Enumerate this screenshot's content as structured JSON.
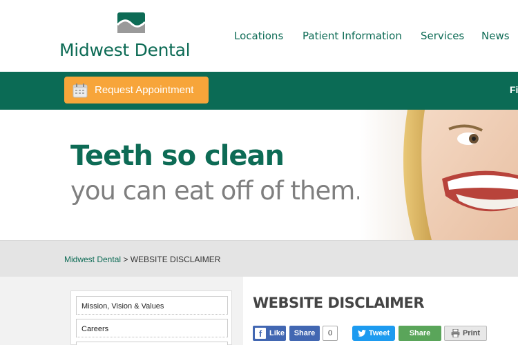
{
  "brand": {
    "name": "Midwest Dental",
    "logo_icon": "wave-tooth-logo-icon",
    "green": "#0b6b55",
    "gray": "#7f7f7f",
    "orange": "#f7a53a"
  },
  "nav": {
    "items": [
      {
        "label": "Locations"
      },
      {
        "label": "Patient Information"
      },
      {
        "label": "Services"
      },
      {
        "label": "News"
      }
    ]
  },
  "toolbar": {
    "request_label": "Request Appointment",
    "request_icon": "calendar-icon",
    "cut_off_label": "Fi"
  },
  "hero": {
    "headline": "Teeth so clean",
    "subhead": "you can eat off of them."
  },
  "breadcrumb": {
    "home": "Midwest Dental",
    "separator": " > ",
    "current": "WEBSITE DISCLAIMER"
  },
  "sidebar": {
    "items": [
      {
        "label": "Mission, Vision & Values"
      },
      {
        "label": "Careers"
      },
      {
        "label": ""
      }
    ]
  },
  "main": {
    "title": "WEBSITE DISCLAIMER"
  },
  "social": {
    "like_label": "Like",
    "fb_share_label": "Share",
    "share_count": "0",
    "tweet_label": "Tweet",
    "share_label": "Share",
    "print_label": "Print"
  }
}
